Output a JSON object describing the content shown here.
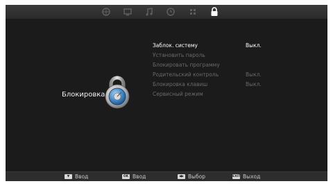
{
  "tabs": [
    {
      "icon": "globe-icon",
      "active": false
    },
    {
      "icon": "monitor-icon",
      "active": false
    },
    {
      "icon": "music-note-icon",
      "active": false
    },
    {
      "icon": "clock-icon",
      "active": false
    },
    {
      "icon": "grid-icon",
      "active": false
    },
    {
      "icon": "padlock-icon",
      "active": true
    }
  ],
  "section": {
    "label": "Блокировка",
    "icon": "padlock-icon"
  },
  "menu": {
    "items": [
      {
        "label": "Заблок. систему",
        "value": "Выкл.",
        "state": "selected"
      },
      {
        "label": "Установить пароль",
        "value": "",
        "state": "dim"
      },
      {
        "label": "Блокировать программу",
        "value": "",
        "state": "dim"
      },
      {
        "label": "Родительский контроль",
        "value": "Выкл.",
        "state": "dim"
      },
      {
        "label": "Блокировка клавиш",
        "value": "Выкл.",
        "state": "dim"
      },
      {
        "label": "Сервисный режим",
        "value": "",
        "state": "dim"
      }
    ]
  },
  "footer": {
    "hints": [
      {
        "key": "",
        "key_icon": "down-arrow-key-icon",
        "label": "Ввод"
      },
      {
        "key": "OK",
        "key_icon": "ok-key-icon",
        "label": "Ввод"
      },
      {
        "key": "",
        "key_icon": "left-right-key-icon",
        "label": "Выбор"
      },
      {
        "key": "EXIT",
        "key_icon": "exit-key-icon",
        "label": "Выход"
      }
    ]
  },
  "colors": {
    "background": "#1b1b1b",
    "active_tab": "#ffffff",
    "inactive_tab": "#5e5e5e",
    "selected_text": "#ffffff",
    "dim_text": "#6a6a6a"
  }
}
